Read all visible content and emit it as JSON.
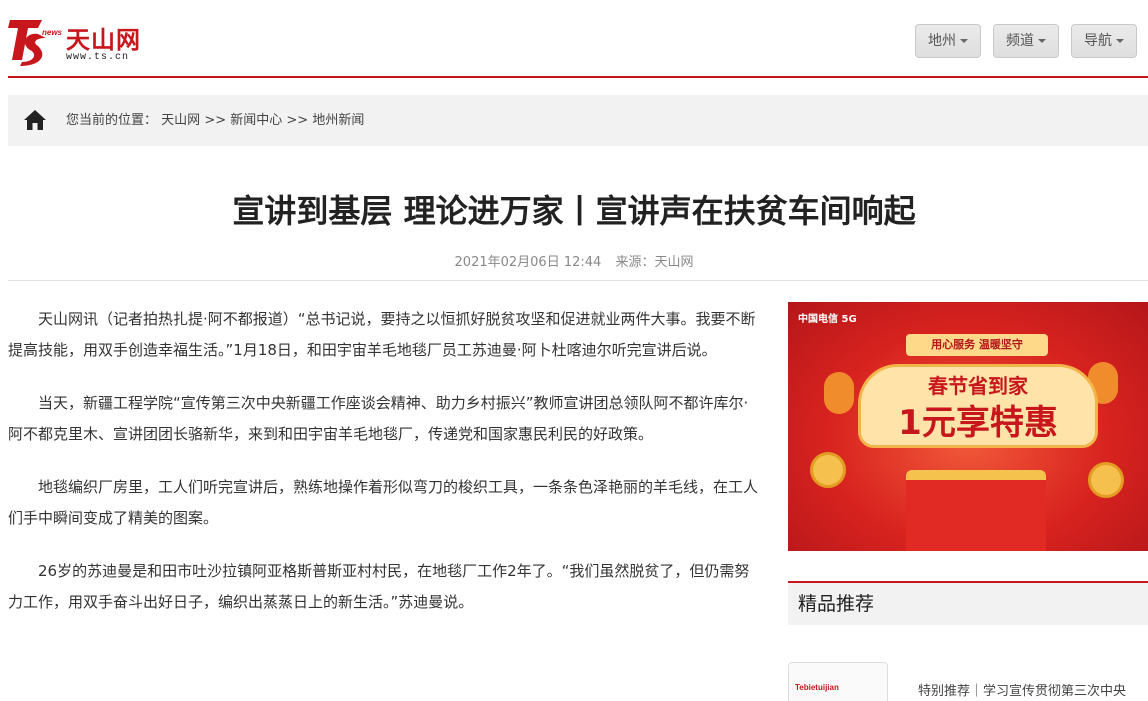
{
  "brand": {
    "logo_news": "news",
    "name": "天山网",
    "url": "www.ts.cn"
  },
  "nav": {
    "region_label": "地州",
    "channel_label": "频道",
    "navigation_label": "导航"
  },
  "breadcrumb": {
    "prefix": "您当前的位置：",
    "items": [
      "天山网",
      "新闻中心",
      "地州新闻"
    ],
    "separator": ">>"
  },
  "article": {
    "title": "宣讲到基层 理论进万家丨宣讲声在扶贫车间响起",
    "datetime": "2021年02月06日 12:44",
    "source": "来源：天山网",
    "paragraphs": [
      "天山网讯（记者拍热扎提·阿不都报道）“总书记说，要持之以恒抓好脱贫攻坚和促进就业两件大事。我要不断提高技能，用双手创造幸福生活。”1月18日，和田宇宙羊毛地毯厂员工苏迪曼·阿卜杜喀迪尔听完宣讲后说。",
      "当天，新疆工程学院“宣传第三次中央新疆工作座谈会精神、助力乡村振兴”教师宣讲团总领队阿不都许库尔·阿不都克里木、宣讲团团长骆新华，来到和田宇宙羊毛地毯厂，传递党和国家惠民利民的好政策。",
      "地毯编织厂房里，工人们听完宣讲后，熟练地操作着形似弯刀的梭织工具，一条条色泽艳丽的羊毛线，在工人们手中瞬间变成了精美的图案。",
      "26岁的苏迪曼是和田市吐沙拉镇阿亚格斯普斯亚村村民，在地毯厂工作2年了。“我们虽然脱贫了，但仍需努力工作，用双手奋斗出好日子，编织出蒸蒸日上的新生活。”苏迪曼说。"
    ]
  },
  "ad": {
    "brand": "中国电信 5G",
    "banner": "用心服务 温暖坚守",
    "headline_1": "春节省到家",
    "headline_2": "1元享特惠"
  },
  "sidebar": {
    "section_title": "精品推荐",
    "thumb_text": "Tebietuijian",
    "item_text": "特别推荐｜学习宣传贯彻第三次中央"
  },
  "colors": {
    "accent_red": "#c8161d",
    "bar_gray": "#f2f2f2"
  }
}
